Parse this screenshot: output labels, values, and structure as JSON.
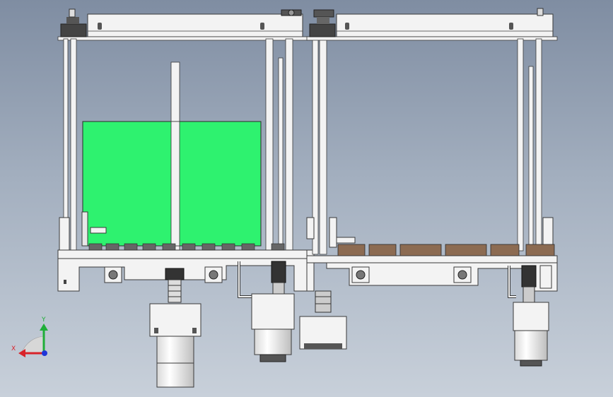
{
  "viewport": {
    "background_top": "#7f8da2",
    "background_bottom": "#c8d0da"
  },
  "model": {
    "panel_color": "#2ef26f",
    "metal_color": "#f3f3f3",
    "outline_color": "#3a3a3a",
    "belt_color": "#3b3b3b",
    "pad_color": "#8c6b52"
  },
  "triad": {
    "x_label": "X",
    "y_label": "Y",
    "x_color": "#d8232a",
    "y_color": "#1fae38",
    "z_color": "#2036d8"
  }
}
